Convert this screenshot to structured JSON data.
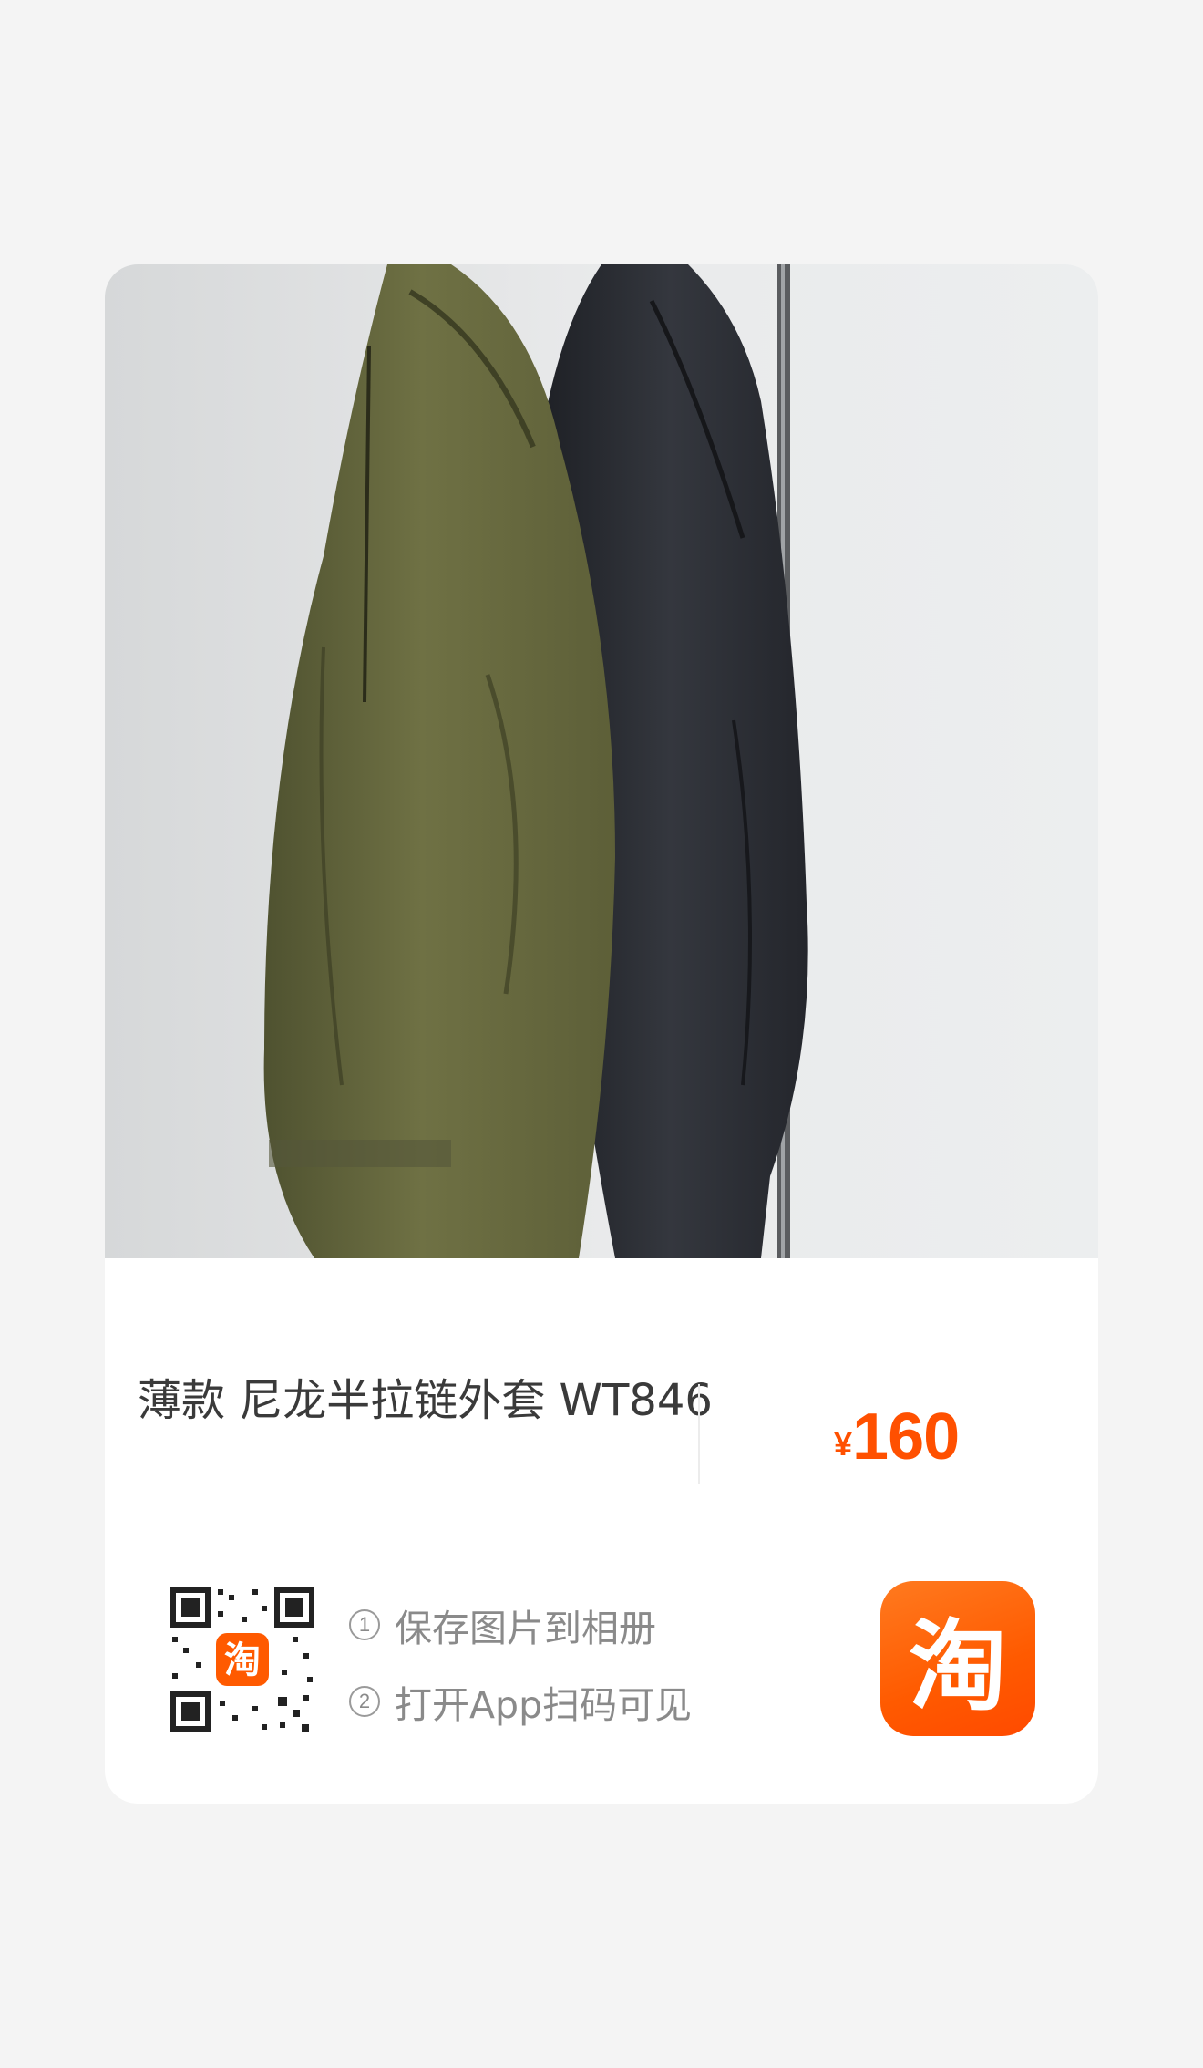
{
  "product": {
    "title": "薄款 尼龙半拉链外套 WT846",
    "price_symbol": "¥",
    "price_value": "160",
    "image_icon": "product-photo-jackets"
  },
  "share": {
    "qr_icon": "qr-code-icon",
    "qr_badge": "淘",
    "steps": [
      {
        "num": "1",
        "label": "保存图片到相册"
      },
      {
        "num": "2",
        "label": "打开App扫码可见"
      }
    ]
  },
  "brand": {
    "logo_glyph": "淘",
    "logo_icon": "taobao-logo-icon",
    "accent": "#ff5000"
  }
}
